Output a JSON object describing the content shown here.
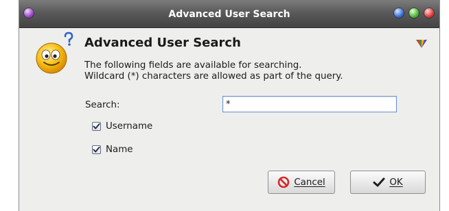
{
  "window": {
    "title": "Advanced User Search"
  },
  "dialog": {
    "heading": "Advanced User Search",
    "description_line1": "The following fields are available for searching.",
    "description_line2": "Wildcard (*) characters are allowed as part of the query."
  },
  "search": {
    "label": "Search:",
    "value": "*"
  },
  "fields": [
    {
      "label": "Username",
      "checked": true
    },
    {
      "label": "Name",
      "checked": true
    }
  ],
  "buttons": {
    "cancel_label": "Cancel",
    "ok_label": "OK"
  },
  "icons": {
    "window_menu": "menu-orb-icon",
    "minimize": "minimize-orb-icon",
    "maximize": "maximize-orb-icon",
    "close": "close-orb-icon",
    "dialog": "smiley-question-icon",
    "app": "gem-icon",
    "cancel": "cancel-icon",
    "ok": "checkmark-icon"
  },
  "colors": {
    "titlebar": "#5a5a5a",
    "dialog_bg": "#eeeeec",
    "input_border": "#6a8fd1",
    "cancel_red": "#d42a2a"
  }
}
